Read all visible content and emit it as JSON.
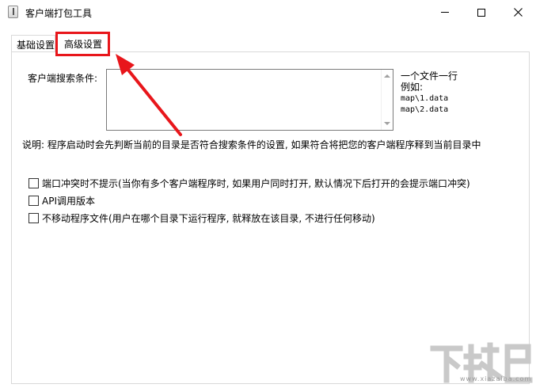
{
  "window": {
    "title": "客户端打包工具",
    "icon": "app-icon",
    "controls": [
      "minimize-icon",
      "maximize-icon",
      "close-icon"
    ]
  },
  "tabs": [
    {
      "label": "基础设置",
      "selected": false
    },
    {
      "label": "高级设置",
      "selected": true,
      "highlight_color": "#e8161b"
    }
  ],
  "advanced": {
    "search_label": "客户端搜索条件:",
    "search_value": "",
    "hint": [
      "一个文件一行",
      "例如:",
      "map\\1.data",
      "map\\2.data"
    ],
    "description": "说明: 程序启动时会先判断当前的目录是否符合搜索条件的设置, 如果符合将把您的客户端程序释到当前目录中",
    "options": [
      {
        "label": "端口冲突时不提示(当你有多个客户端程序时, 如果用户同时打开, 默认情况下后打开的会提示端口冲突)",
        "checked": false
      },
      {
        "label": "API调用版本",
        "checked": false
      },
      {
        "label": "不移动程序文件(用户在哪个目录下运行程序, 就释放在该目录, 不进行任何移动)",
        "checked": false
      }
    ]
  },
  "annotation": {
    "type": "arrow",
    "color": "#e8161b",
    "points_to": "高级设置"
  },
  "watermark": {
    "text": "下载吧",
    "subtext": "www.xiazaiba.com"
  }
}
